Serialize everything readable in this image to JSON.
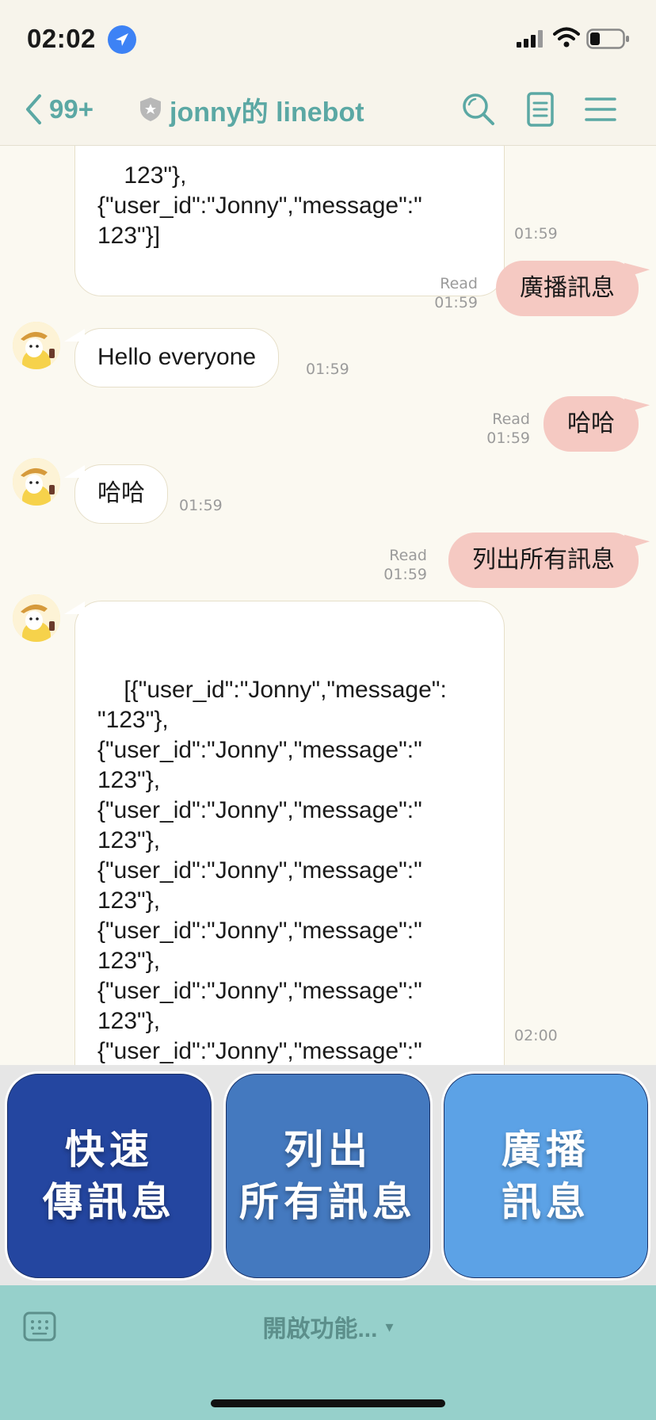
{
  "status_bar": {
    "time": "02:02"
  },
  "header": {
    "back_count": "99+",
    "title": "jonny的 linebot",
    "icons": [
      "search-icon",
      "notes-icon",
      "menu-icon"
    ]
  },
  "messages": [
    {
      "text": "123\"},\n{\"user_id\":\"Jonny\",\"message\":\"\n123\"}]",
      "time": "01:59"
    },
    {
      "text": "廣播訊息",
      "read": "Read",
      "time": "01:59"
    },
    {
      "text": "Hello everyone",
      "time": "01:59"
    },
    {
      "text": "哈哈",
      "read": "Read",
      "time": "01:59"
    },
    {
      "text": "哈哈",
      "time": "01:59"
    },
    {
      "text": "列出所有訊息",
      "read": "Read",
      "time": "01:59"
    },
    {
      "text": "[{\"user_id\":\"Jonny\",\"message\":\n\"123\"},\n{\"user_id\":\"Jonny\",\"message\":\"\n123\"},\n{\"user_id\":\"Jonny\",\"message\":\"\n123\"},\n{\"user_id\":\"Jonny\",\"message\":\"\n123\"},\n{\"user_id\":\"Jonny\",\"message\":\"\n123\"},\n{\"user_id\":\"Jonny\",\"message\":\"\n123\"},\n{\"user_id\":\"Jonny\",\"message\":\"\n哈哈\"}]",
      "time": "02:00"
    }
  ],
  "rich_menu": [
    {
      "line1": "快速",
      "line2": "傳訊息",
      "color": "#2446a0"
    },
    {
      "line1": "列出",
      "line2": "所有訊息",
      "color": "#4479bf"
    },
    {
      "line1": "廣播",
      "line2": "訊息",
      "color": "#5ca2e6"
    }
  ],
  "bottom_bar": {
    "toggle_label": "開啟功能...",
    "arrow": "▾"
  },
  "colors": {
    "accent": "#5ba8a4",
    "outgoing_bubble": "#f5c9c2",
    "bottom_bar": "#96d0cb"
  }
}
